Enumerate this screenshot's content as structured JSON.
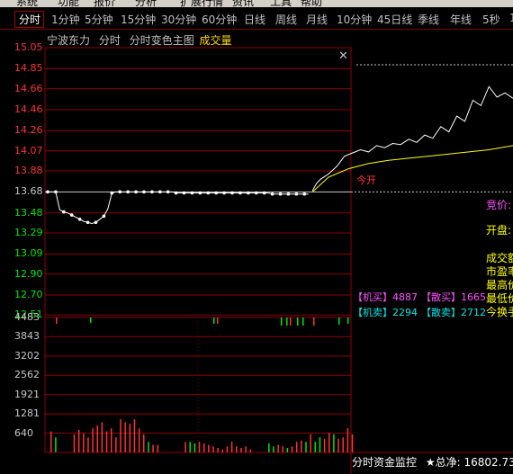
{
  "menu": {
    "items": [
      "系统",
      "功能",
      "报价",
      "分析",
      "扩展行情",
      "资讯",
      "工具",
      "帮助"
    ]
  },
  "periods": {
    "items": [
      "分时",
      "1分钟",
      "5分钟",
      "15分钟",
      "30分钟",
      "60分钟",
      "日线",
      "周线",
      "月线",
      "10分钟",
      "45日线",
      "季线",
      "年线",
      "5秒",
      "1"
    ],
    "selected": "分时"
  },
  "info": {
    "stock_name": "宁波东力",
    "mode": "分时",
    "variant": "分时变色主图",
    "indicator": "成交量"
  },
  "colors": {
    "up": "#ff3232",
    "down": "#00e600",
    "flat": "#c8c8c8",
    "grid": "#8b0000",
    "price_line": "#ffffff",
    "avg_line": "#ffff00",
    "volume_axis": "#c8c8c8"
  },
  "icons": {
    "close": "close-icon"
  },
  "overlay": {
    "start_label": "今开",
    "bid_price_label": "竞价:",
    "open_label": "开盘:",
    "labels": [
      "成交额",
      "市盈率",
      "最高价",
      "最低价",
      "今换手"
    ],
    "big_buy_label": "【机买】",
    "big_buy_value": "4887",
    "retail_buy_label": "【散买】",
    "retail_buy_value": "1665",
    "big_sell_label": "【机卖】",
    "big_sell_value": "2294",
    "retail_sell_label": "【散卖】",
    "retail_sell_value": "2712"
  },
  "bottom_bar": {
    "label": "分时资金监控",
    "total_label": "★总净:",
    "total_value": "16802.73"
  },
  "chart_data": [
    {
      "type": "line",
      "title": "分时",
      "y_ticks": [
        "15.05",
        "14.85",
        "14.66",
        "14.46",
        "14.26",
        "14.07",
        "13.88",
        "13.68",
        "13.48",
        "13.29",
        "13.09",
        "12.90",
        "12.70",
        "12.51"
      ],
      "y_tick_colors": [
        "up",
        "up",
        "up",
        "up",
        "up",
        "up",
        "up",
        "flat",
        "down",
        "down",
        "down",
        "down",
        "down",
        "down"
      ],
      "prev_close": 13.68,
      "ylim": [
        12.41,
        15.05
      ],
      "series": [
        {
          "x": [
            0,
            1,
            2,
            3,
            4,
            5,
            6,
            7,
            8,
            9,
            10,
            11,
            12,
            13,
            14,
            15,
            16,
            17,
            18,
            19,
            20,
            21,
            22,
            23,
            24,
            25,
            26,
            27,
            28,
            29,
            30,
            31,
            32,
            33,
            34,
            35,
            36,
            37,
            38,
            39,
            40,
            41,
            42,
            43,
            44,
            45,
            46,
            47,
            48,
            49,
            50,
            51,
            52,
            53,
            54,
            55,
            56,
            57,
            58,
            59,
            60,
            61,
            62,
            63,
            64,
            65
          ],
          "values": [
            13.68,
            13.68,
            13.68,
            13.51,
            13.49,
            13.48,
            13.46,
            13.44,
            13.42,
            13.4,
            13.39,
            13.38,
            13.39,
            13.42,
            13.45,
            13.52,
            13.67,
            13.68,
            13.68,
            13.68,
            13.68,
            13.68,
            13.68,
            13.68,
            13.68,
            13.68,
            13.68,
            13.68,
            13.68,
            13.68,
            13.68,
            13.68,
            13.67,
            13.67,
            13.67,
            13.67,
            13.67,
            13.67,
            13.67,
            13.67,
            13.67,
            13.67,
            13.67,
            13.67,
            13.67,
            13.67,
            13.67,
            13.67,
            13.67,
            13.67,
            13.67,
            13.67,
            13.67,
            13.67,
            13.67,
            13.67,
            13.66,
            13.66,
            13.66,
            13.66,
            13.66,
            13.66,
            13.66,
            13.66,
            13.66,
            13.66
          ]
        },
        {
          "x": [
            66,
            67,
            68,
            70,
            72,
            74,
            76,
            78,
            80,
            82,
            84,
            86,
            88,
            90,
            92,
            94,
            96,
            98,
            100,
            102,
            104,
            106,
            108,
            110,
            112,
            114,
            116
          ],
          "values": [
            13.69,
            13.76,
            13.8,
            13.85,
            13.92,
            14.02,
            14.05,
            14.08,
            14.06,
            14.12,
            14.1,
            14.14,
            14.13,
            14.18,
            14.15,
            14.22,
            14.19,
            14.3,
            14.25,
            14.4,
            14.35,
            14.55,
            14.5,
            14.68,
            14.58,
            14.62,
            14.57
          ]
        },
        {
          "x": [
            66,
            70,
            75,
            80,
            85,
            90,
            95,
            100,
            105,
            110,
            116
          ],
          "values": [
            13.68,
            13.82,
            13.9,
            13.95,
            13.98,
            14.0,
            14.02,
            14.04,
            14.06,
            14.08,
            14.12
          ]
        }
      ],
      "x_range": [
        0,
        116
      ]
    },
    {
      "type": "bar",
      "title": "成交量",
      "y_ticks": [
        "4483",
        "3843",
        "3202",
        "2562",
        "1921",
        "1281",
        "640"
      ],
      "ylim": [
        0,
        4483
      ],
      "values": [
        700,
        500,
        0,
        0,
        0,
        600,
        750,
        620,
        500,
        800,
        900,
        1000,
        700,
        800,
        500,
        1100,
        1000,
        950,
        1100,
        800,
        600,
        350,
        250,
        250,
        0,
        0,
        0,
        0,
        0,
        350,
        350,
        300,
        350,
        300,
        250,
        200,
        150,
        100,
        200,
        350,
        200,
        150,
        200,
        100,
        0,
        0,
        0,
        300,
        200,
        250,
        200,
        150,
        200,
        350,
        400,
        350,
        600,
        350,
        500,
        450,
        650,
        600,
        450,
        500,
        800,
        600
      ],
      "colors": [
        "up",
        "down",
        "up",
        "up",
        "up",
        "up",
        "up",
        "up",
        "up",
        "up",
        "up",
        "up",
        "up",
        "up",
        "up",
        "up",
        "up",
        "up",
        "up",
        "up",
        "up",
        "down",
        "up",
        "up",
        "up",
        "up",
        "up",
        "up",
        "up",
        "up",
        "down",
        "down",
        "up",
        "up",
        "up",
        "up",
        "up",
        "up",
        "up",
        "up",
        "up",
        "up",
        "up",
        "up",
        "up",
        "up",
        "up",
        "down",
        "down",
        "up",
        "up",
        "down",
        "up",
        "up",
        "up",
        "down",
        "up",
        "down",
        "down",
        "up",
        "up",
        "down",
        "up",
        "up",
        "up",
        "up"
      ]
    }
  ]
}
